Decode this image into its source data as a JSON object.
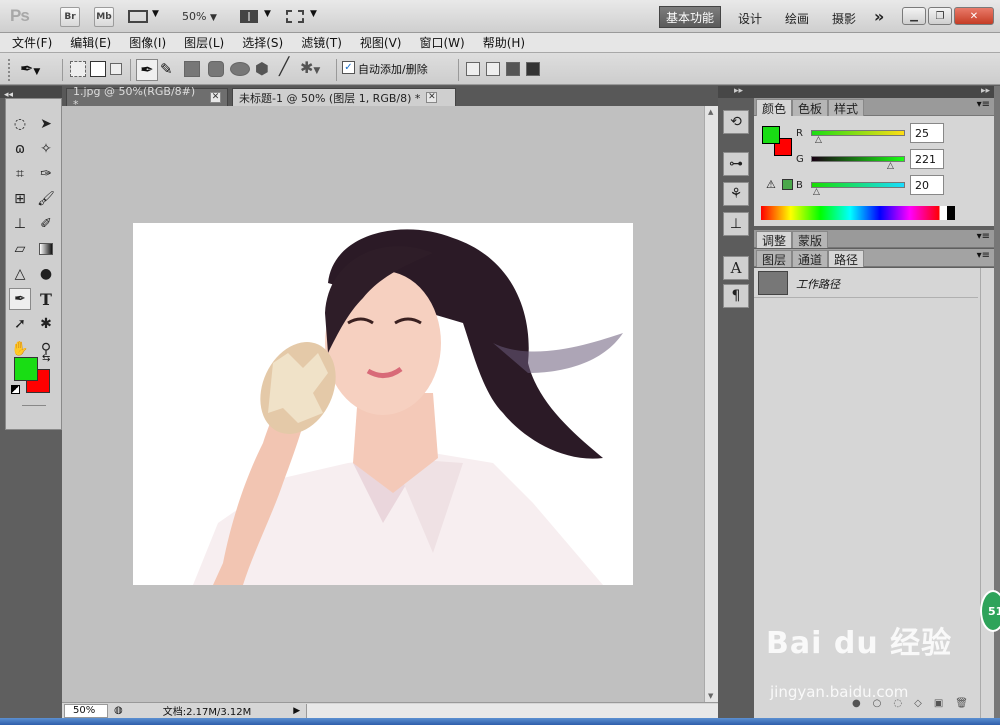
{
  "appbar": {
    "logo": "Ps",
    "bridge": "Br",
    "minibridge": "Mb",
    "zoom": "50%",
    "workspaces": {
      "active": "基本功能",
      "items": [
        "设计",
        "绘画",
        "摄影"
      ]
    },
    "more": "»"
  },
  "menu": [
    "文件(F)",
    "编辑(E)",
    "图像(I)",
    "图层(L)",
    "选择(S)",
    "滤镜(T)",
    "视图(V)",
    "窗口(W)",
    "帮助(H)"
  ],
  "options": {
    "auto_add_delete": "自动添加/删除",
    "auto_checked": true
  },
  "tabs": [
    {
      "label": "1.jpg @ 50%(RGB/8#) *",
      "active": false
    },
    {
      "label": "未标题-1 @ 50% (图层 1, RGB/8) *",
      "active": true
    }
  ],
  "status": {
    "zoom": "50%",
    "doc": "文档:2.17M/3.12M"
  },
  "color_panel": {
    "tabs": [
      "颜色",
      "色板",
      "样式"
    ],
    "r": {
      "label": "R",
      "value": "25"
    },
    "g": {
      "label": "G",
      "value": "221"
    },
    "b": {
      "label": "B",
      "value": "20"
    },
    "fg_color": "#19dd14",
    "bg_color": "#ff0000"
  },
  "adjust_panel": {
    "tabs": [
      "调整",
      "蒙版"
    ]
  },
  "layers_panel": {
    "tabs": [
      "图层",
      "通道",
      "路径"
    ],
    "path_item": "工作路径"
  },
  "watermark": {
    "brand": "Bai du 经验",
    "url": "jingyan.baidu.com",
    "badge": "51"
  }
}
